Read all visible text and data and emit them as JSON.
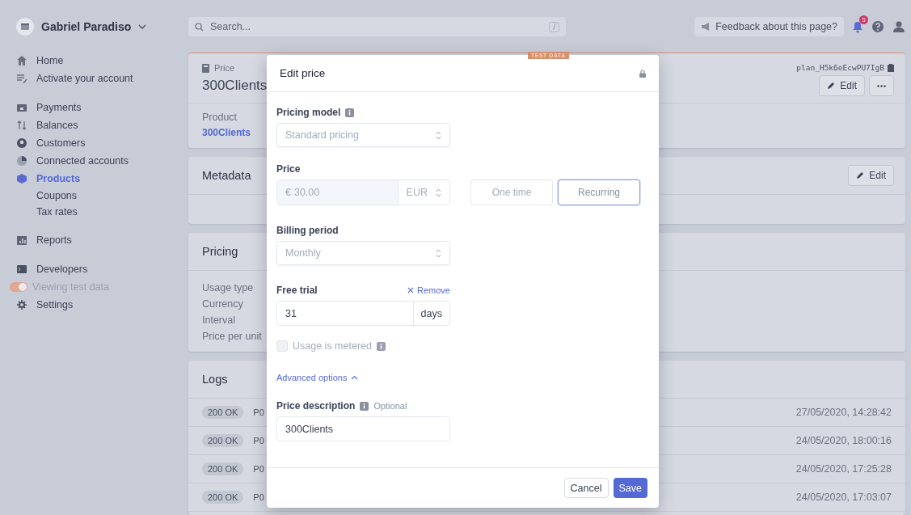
{
  "account": {
    "name": "Gabriel Paradiso"
  },
  "sidebar": {
    "sections": [
      [
        {
          "label": "Home",
          "selected": false
        },
        {
          "label": "Activate your account",
          "selected": false
        }
      ],
      [
        {
          "label": "Payments",
          "selected": false
        },
        {
          "label": "Balances",
          "selected": false
        },
        {
          "label": "Customers",
          "selected": false
        },
        {
          "label": "Connected accounts",
          "selected": false
        },
        {
          "label": "Products",
          "selected": true,
          "children": [
            {
              "label": "Coupons",
              "selected": false
            },
            {
              "label": "Tax rates",
              "selected": false
            }
          ]
        }
      ],
      [
        {
          "label": "Reports",
          "selected": false
        }
      ],
      [
        {
          "label": "Developers",
          "selected": false
        },
        {
          "label": "Viewing test data",
          "kind": "toggle",
          "on": true
        },
        {
          "label": "Settings",
          "selected": false
        }
      ]
    ]
  },
  "topbar": {
    "search": {
      "placeholder": "Search...",
      "shortcut": "/"
    },
    "feedback": "Feedback about this page?",
    "notifications": "5"
  },
  "price_card": {
    "badge": "TEST DATA",
    "label": "Price",
    "title": "300Clients",
    "id": "plan_H5k6eEcwPU7IgB",
    "edit": "Edit",
    "product_label": "Product",
    "product": "300Clients"
  },
  "metadata": {
    "title": "Metadata",
    "edit": "Edit"
  },
  "pricing": {
    "title": "Pricing",
    "rows": [
      "Usage type",
      "Currency",
      "Interval",
      "Price per unit"
    ]
  },
  "logs": {
    "title": "Logs",
    "rows": [
      {
        "status": "200 OK",
        "path": "P0",
        "time": "27/05/2020, 14:28:42"
      },
      {
        "status": "200 OK",
        "path": "P0",
        "time": "24/05/2020, 18:00:16"
      },
      {
        "status": "200 OK",
        "path": "P0",
        "time": "24/05/2020, 17:25:28"
      },
      {
        "status": "200 OK",
        "path": "P0",
        "time": "24/05/2020, 17:03:07"
      }
    ]
  },
  "modal": {
    "title": "Edit price",
    "pricing_model": {
      "label": "Pricing model",
      "value": "Standard pricing",
      "disabled": true
    },
    "price": {
      "label": "Price",
      "symbol": "€",
      "amount": "30.00",
      "currency": "EUR",
      "disabled": true
    },
    "price_type": [
      {
        "label": "One time",
        "selected": false
      },
      {
        "label": "Recurring",
        "selected": true
      }
    ],
    "billing_period": {
      "label": "Billing period",
      "value": "Monthly",
      "disabled": true
    },
    "free_trial": {
      "label": "Free trial",
      "remove": "Remove",
      "value": "31",
      "unit": "days"
    },
    "metered": {
      "label": "Usage is metered",
      "checked": false,
      "disabled": true
    },
    "advanced": {
      "label": "Advanced options",
      "expanded": true
    },
    "description": {
      "label": "Price description",
      "optional": "Optional",
      "value": "300Clients"
    },
    "buttons": {
      "cancel": "Cancel",
      "save": "Save"
    }
  }
}
